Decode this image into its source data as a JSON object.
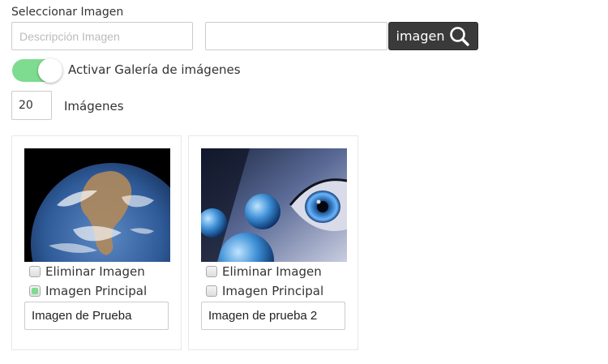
{
  "header": {
    "section_label": "Seleccionar Imagen",
    "description_placeholder": "Descripción Imagen",
    "file_value": "",
    "image_button_label": "imagen"
  },
  "gallery_toggle": {
    "label": "Activar Galería de imágenes",
    "on": true
  },
  "image_count": {
    "value": "20",
    "label": "Imágenes"
  },
  "cards": [
    {
      "delete_label": "Eliminar Imagen",
      "main_label": "Imagen Principal",
      "delete_checked": false,
      "main_checked": true,
      "name": "Imagen de Prueba",
      "thumb": "earth-photo"
    },
    {
      "delete_label": "Eliminar Imagen",
      "main_label": "Imagen Principal",
      "delete_checked": false,
      "main_checked": false,
      "name": "Imagen de prueba 2",
      "thumb": "eye-with-planets-photo"
    }
  ],
  "colors": {
    "toggle_on": "#7ddc8f",
    "button_bg": "#3a3a3a"
  }
}
